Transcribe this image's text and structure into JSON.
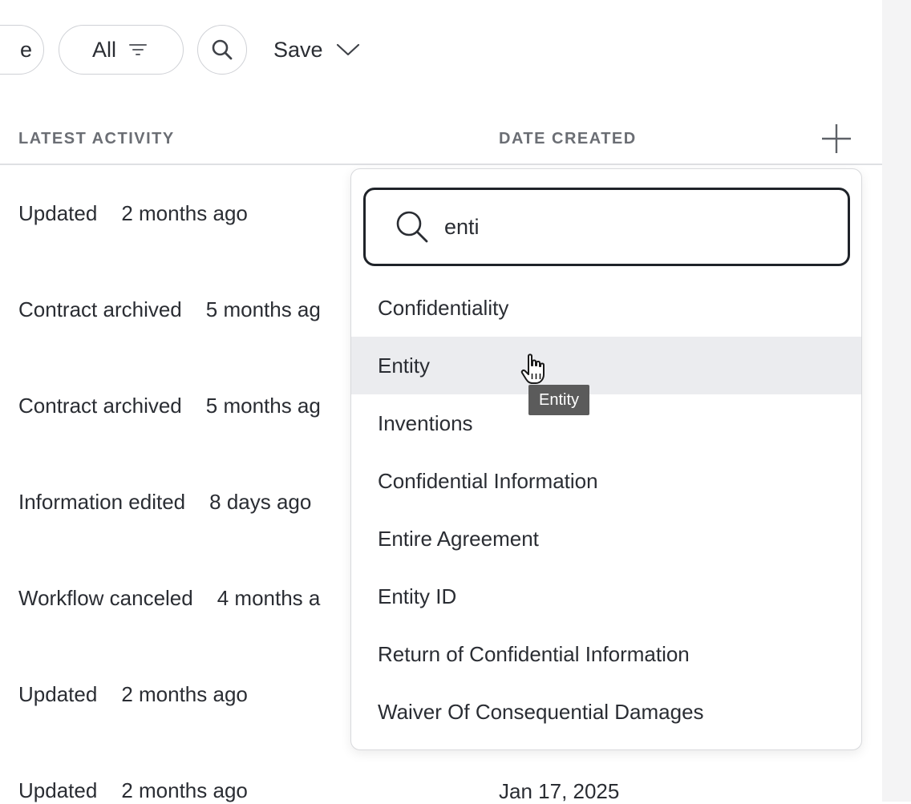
{
  "toolbar": {
    "partial_filter_label": "e",
    "all_filter_label": "All",
    "save_label": "Save"
  },
  "table": {
    "headers": {
      "latest_activity": "LATEST ACTIVITY",
      "date_created": "DATE CREATED"
    },
    "rows": [
      {
        "activity": "Updated",
        "time": "2 months ago"
      },
      {
        "activity": "Contract archived",
        "time": "5 months ag"
      },
      {
        "activity": "Contract archived",
        "time": "5 months ag"
      },
      {
        "activity": "Information edited",
        "time": "8 days ago"
      },
      {
        "activity": "Workflow canceled",
        "time": "4 months a"
      },
      {
        "activity": "Updated",
        "time": "2 months ago"
      },
      {
        "activity": "Updated",
        "time": "2 months ago",
        "date_created": "Jan 17, 2025"
      }
    ]
  },
  "dropdown": {
    "search_value": "enti",
    "options": [
      {
        "label": "Confidentiality"
      },
      {
        "label": "Entity"
      },
      {
        "label": "Inventions"
      },
      {
        "label": "Confidential Information"
      },
      {
        "label": "Entire Agreement"
      },
      {
        "label": "Entity ID"
      },
      {
        "label": "Return of Confidential Information"
      },
      {
        "label": "Waiver Of Consequential Damages"
      }
    ],
    "hovered_option": "Entity",
    "tooltip": "Entity"
  },
  "icons": [
    "filter-icon",
    "search-icon",
    "chevron-down-icon",
    "plus-icon",
    "search-icon",
    "hand-pointer-icon"
  ]
}
